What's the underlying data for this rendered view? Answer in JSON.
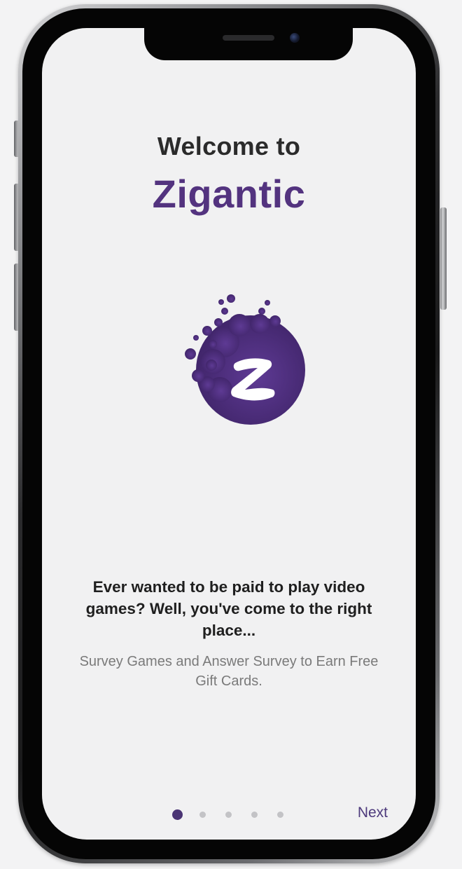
{
  "onboarding": {
    "welcome_text": "Welcome to",
    "app_name": "Zigantic",
    "headline": "Ever wanted to be paid to play video games? Well, you've come to the right place...",
    "description": "Survey Games and Answer Survey to Earn Free Gift Cards.",
    "next_label": "Next",
    "page_count": 5,
    "current_page": 1
  },
  "logo": {
    "icon": "zigantic-logo-icon",
    "letter": "Z"
  },
  "colors": {
    "brand_purple": "#53337f",
    "logo_purple": "#4e2f7f",
    "background": "#f1f1f2",
    "headline_text": "#1f1f1f",
    "subtext": "#7a7a7a",
    "dot_inactive": "#c3c3c6",
    "dot_active": "#4a3474"
  }
}
